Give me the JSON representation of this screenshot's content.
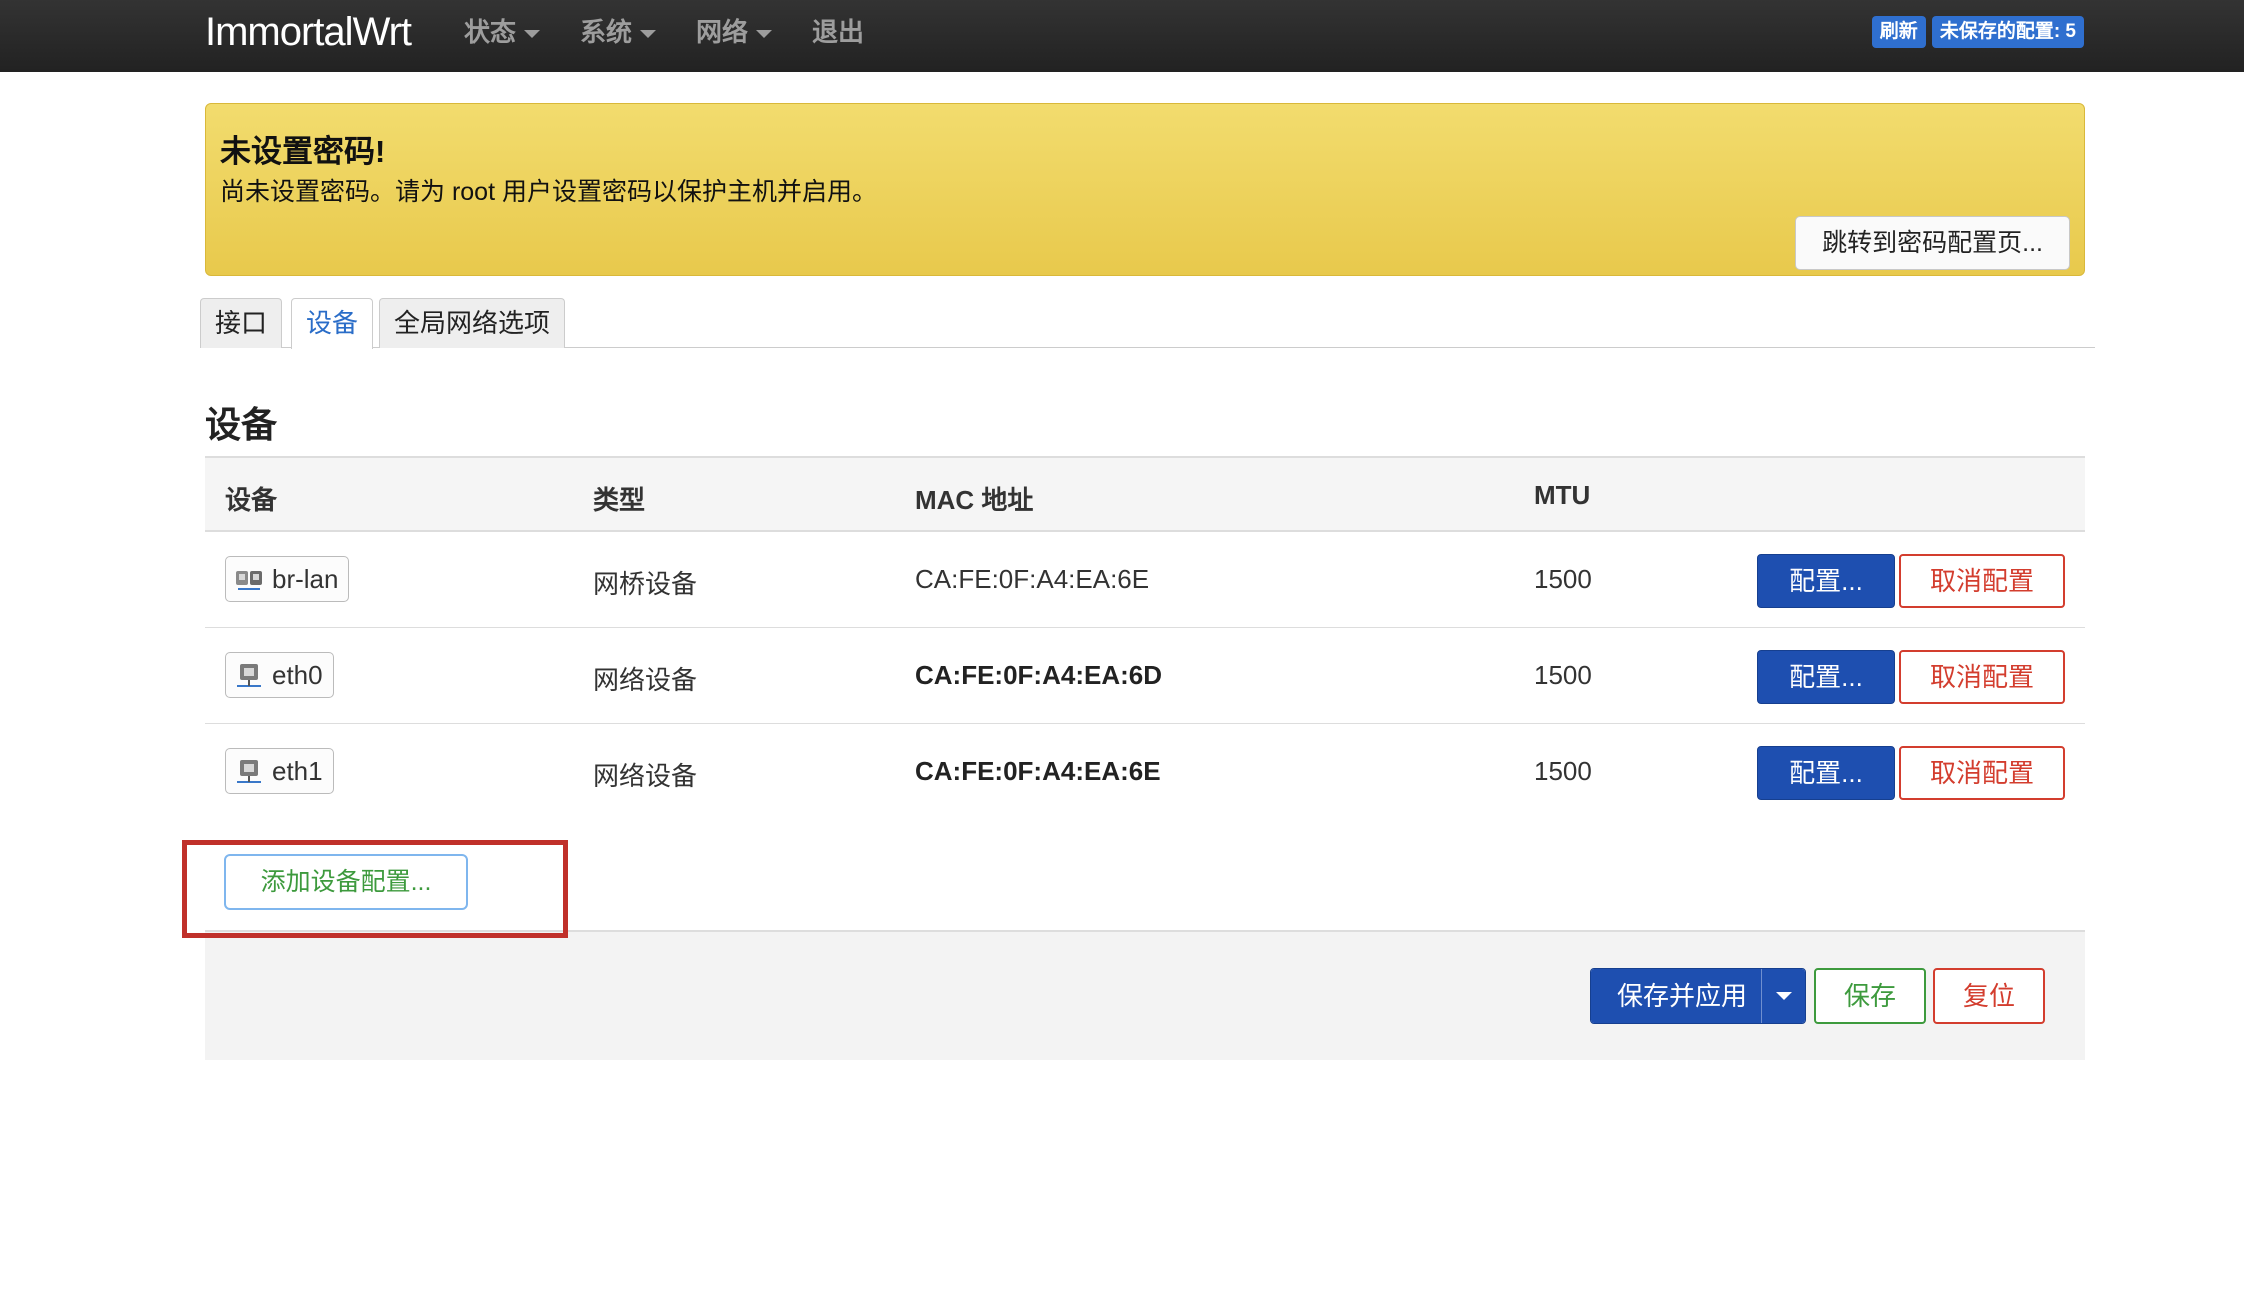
{
  "navbar": {
    "brand": "ImmortalWrt",
    "menu": [
      {
        "label": "状态",
        "has_caret": true
      },
      {
        "label": "系统",
        "has_caret": true
      },
      {
        "label": "网络",
        "has_caret": true
      },
      {
        "label": "退出",
        "has_caret": false
      }
    ],
    "indicators": {
      "refresh": "刷新",
      "unsaved": "未保存的配置: 5"
    }
  },
  "alert": {
    "title": "未设置密码!",
    "text": "尚未设置密码。请为 root 用户设置密码以保护主机并启用。",
    "button": "跳转到密码配置页..."
  },
  "tabs": [
    {
      "label": "接口",
      "active": false
    },
    {
      "label": "设备",
      "active": true
    },
    {
      "label": "全局网络选项",
      "active": false
    }
  ],
  "section": {
    "title": "设备",
    "columns": [
      "设备",
      "类型",
      "MAC 地址",
      "MTU"
    ],
    "rows": [
      {
        "device": "br-lan",
        "icon": "bridge-icon",
        "type": "网桥设备",
        "mac": "CA:FE:0F:A4:EA:6E",
        "mtu": "1500",
        "configure": "配置...",
        "unconfigure": "取消配置"
      },
      {
        "device": "eth0",
        "icon": "ethernet-icon",
        "type": "网络设备",
        "mac": "CA:FE:0F:A4:EA:6D",
        "mtu": "1500",
        "configure": "配置...",
        "unconfigure": "取消配置"
      },
      {
        "device": "eth1",
        "icon": "ethernet-icon",
        "type": "网络设备",
        "mac": "CA:FE:0F:A4:EA:6E",
        "mtu": "1500",
        "configure": "配置...",
        "unconfigure": "取消配置"
      }
    ],
    "add_button": "添加设备配置..."
  },
  "footer": {
    "save_apply": "保存并应用",
    "save": "保存",
    "reset": "复位"
  },
  "colors": {
    "primary": "#1e4fb0",
    "danger": "#d33d2e",
    "success": "#3d9a3d",
    "alert_bg": "#eed35c",
    "highlight": "#c0302a"
  }
}
